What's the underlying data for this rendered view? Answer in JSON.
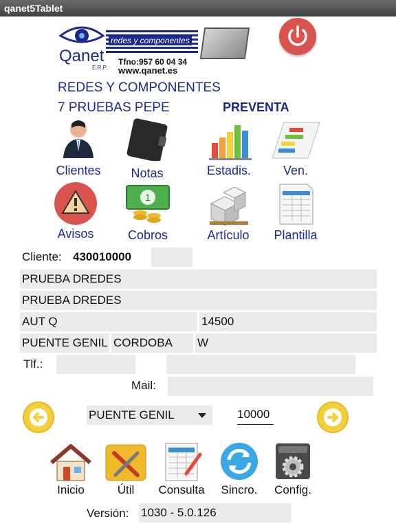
{
  "window": {
    "title": "qanet5Tablet"
  },
  "logo": {
    "brand": "Qanet",
    "erp": "E.R.P.",
    "slogan": "redes y componentes",
    "phone": "Tfno:957 60 04 34",
    "web": "www.qanet.es"
  },
  "company": {
    "name": "REDES Y COMPONENTES",
    "user": "7 PRUEBAS PEPE",
    "mode": "PREVENTA"
  },
  "menu": {
    "clientes": "Clientes",
    "notas": "Notas",
    "estadis": "Estadis.",
    "ven": "Ven.",
    "avisos": "Avisos",
    "cobros": "Cobros",
    "articulo": "Artículo",
    "plantilla": "Plantilla"
  },
  "cliente": {
    "label": "Cliente:",
    "code": "430010000",
    "extra": "",
    "name1": "PRUEBA DREDES",
    "name2": "PRUEBA DREDES",
    "address": "AUT Q",
    "postal": "14500",
    "city": "PUENTE GENIL",
    "province": "CORDOBA",
    "country": "W",
    "tlf_label": "Tlf.:",
    "tlf1": "",
    "tlf2": "",
    "mail_label": "Mail:",
    "mail": ""
  },
  "route": {
    "selected": "PUENTE GENIL",
    "code": "10000"
  },
  "bottom": {
    "inicio": "Inicio",
    "util": "Útil",
    "consulta": "Consulta",
    "sincro": "Sincro.",
    "config": "Config."
  },
  "version": {
    "label": "Versión:",
    "value": "1030 - 5.0.126"
  },
  "colors": {
    "accent_blue": "#1b2a8a",
    "power_red": "#d9534f",
    "arrow_yellow": "#f3cf3a",
    "field_gray": "#ebebeb"
  }
}
